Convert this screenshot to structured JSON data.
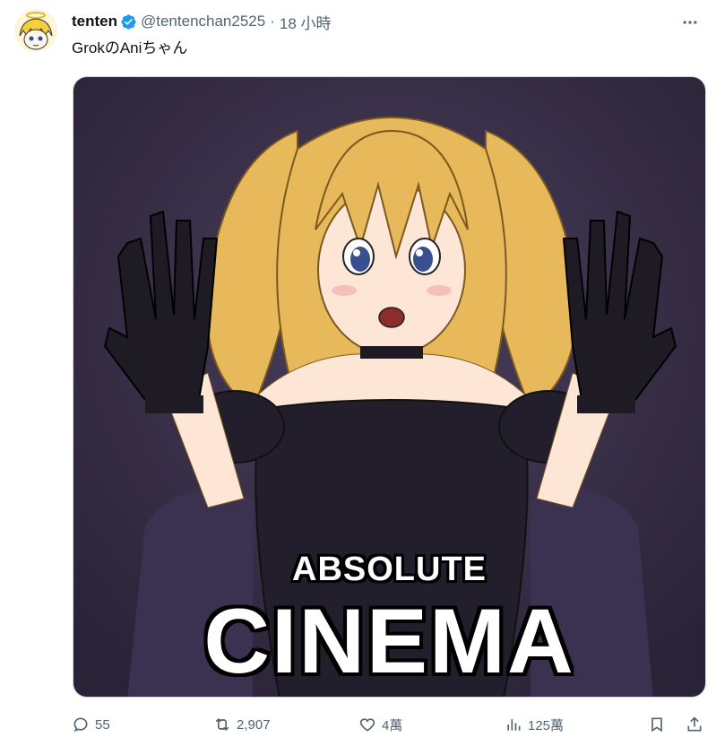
{
  "tweet": {
    "display_name": "tenten",
    "handle": "@tentenchan2525",
    "separator": "·",
    "time": "18 小時",
    "text": "GrokのAniちゃん",
    "verified_color": "#1d9bf0"
  },
  "media": {
    "caption_small": "ABSOLUTE",
    "caption_large": "CINEMA",
    "description_icon": "anime-character-image"
  },
  "actions": {
    "replies": "55",
    "reposts": "2,907",
    "likes": "4萬",
    "views": "125萬"
  },
  "icons": {
    "reply": "comment-icon",
    "repost": "repost-icon",
    "like": "heart-icon",
    "views": "analytics-icon",
    "bookmark": "bookmark-icon",
    "share": "share-icon",
    "more": "more-icon"
  }
}
